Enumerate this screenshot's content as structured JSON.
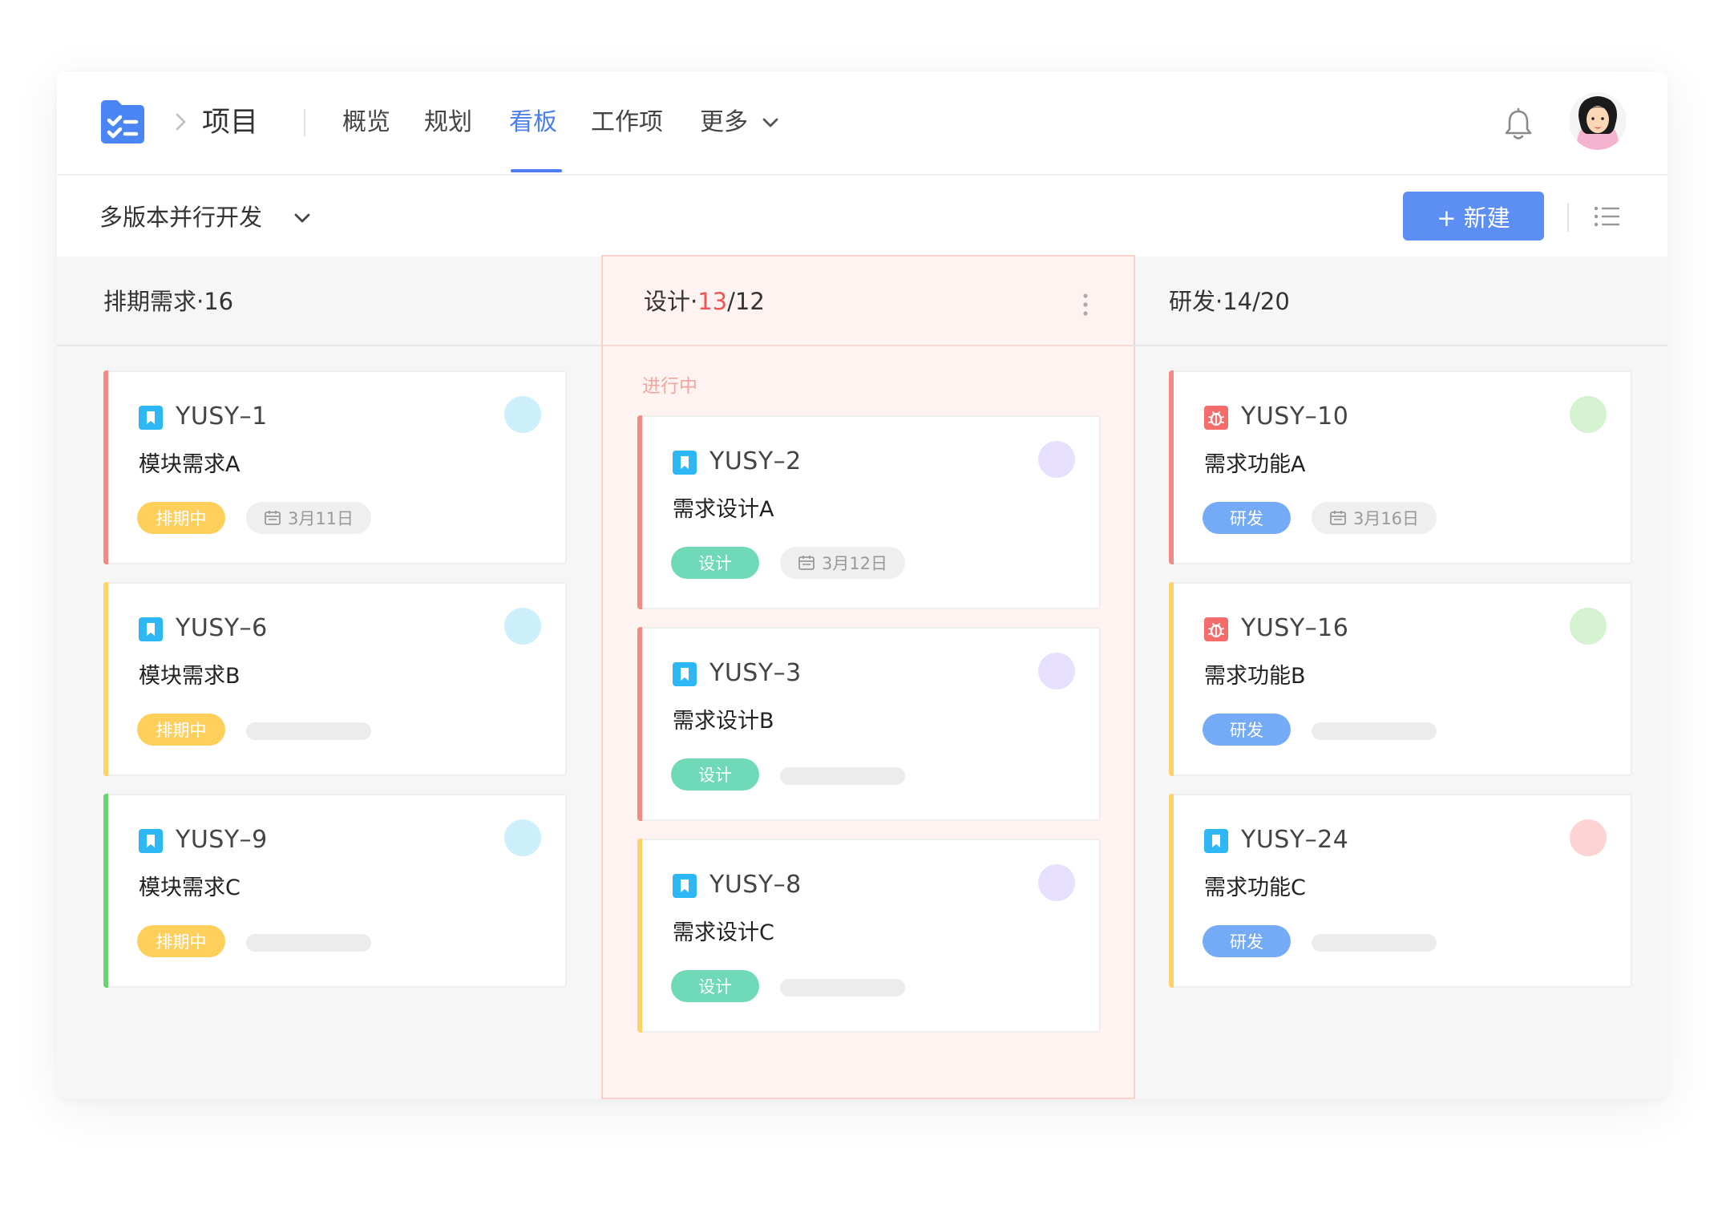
{
  "nav": {
    "project_label": "项目",
    "tabs": [
      {
        "label": "概览"
      },
      {
        "label": "规划"
      },
      {
        "label": "看板"
      },
      {
        "label": "工作项"
      },
      {
        "label": "更多"
      }
    ],
    "active_tab": "看板"
  },
  "toolbar": {
    "version_label": "多版本并行开发",
    "new_button_label": "+ 新建"
  },
  "columns": [
    {
      "title": "排期需求·16"
    },
    {
      "title_prefix": "设计·",
      "title_over": "13",
      "title_suffix": "/12",
      "sub_status": "进行中"
    },
    {
      "title": "研发·14/20"
    }
  ],
  "cards": [
    {
      "key": "YUSY–1",
      "title": "模块需求A",
      "tag": "排期中",
      "date": "3月11日"
    },
    {
      "key": "YUSY–6",
      "title": "模块需求B",
      "tag": "排期中"
    },
    {
      "key": "YUSY–9",
      "title": "模块需求C",
      "tag": "排期中"
    },
    {
      "key": "YUSY–2",
      "title": "需求设计A",
      "tag": "设计",
      "date": "3月12日"
    },
    {
      "key": "YUSY–3",
      "title": "需求设计B",
      "tag": "设计"
    },
    {
      "key": "YUSY–8",
      "title": "需求设计C",
      "tag": "设计"
    },
    {
      "key": "YUSY–10",
      "title": "需求功能A",
      "tag": "研发",
      "date": "3月16日"
    },
    {
      "key": "YUSY–16",
      "title": "需求功能B",
      "tag": "研发"
    },
    {
      "key": "YUSY–24",
      "title": "需求功能C",
      "tag": "研发"
    }
  ],
  "colors": {
    "accent": "#4b7ff1",
    "new_button": "#5c8ef4",
    "tag_scheduled": "#ffcf5c",
    "tag_design": "#6fd9b8",
    "tag_dev": "#75aaf7",
    "bar_red": "#f48a86",
    "bar_yellow": "#ffd36a",
    "bar_green": "#69d372",
    "story_icon": "#2db7f5",
    "bug_icon": "#f56c6c"
  },
  "icons": {
    "logo": "task-folder-icon",
    "story": "bookmark-icon",
    "bug": "bug-icon",
    "date": "calendar-icon"
  }
}
